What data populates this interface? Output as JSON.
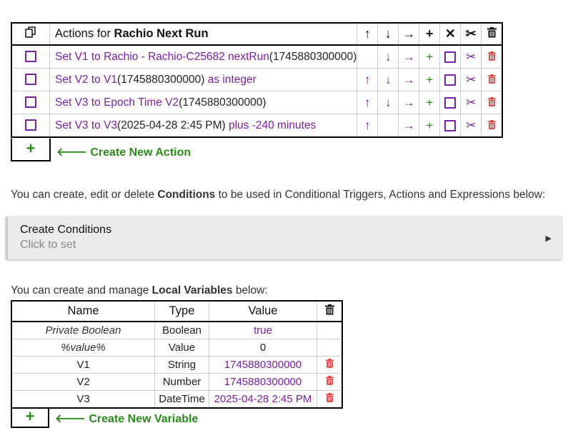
{
  "actions": {
    "header_prefix": "Actions for ",
    "header_name": "Rachio Next Run",
    "header_icons": [
      "↑",
      "↓",
      "→",
      "+",
      "✕",
      "✂",
      "🗑"
    ],
    "rows": [
      {
        "purple1": "Set V1 to Rachio - Rachio-C25682 nextRun",
        "black": "(1745880300000)",
        "purple2": "",
        "up": "",
        "down": "↓"
      },
      {
        "purple1": "Set V2 to V1",
        "black": "(1745880300000)",
        "purple2": " as integer",
        "up": "↑",
        "down": "↓"
      },
      {
        "purple1": "Set V3 to Epoch Time V2",
        "black": "(1745880300000)",
        "purple2": "",
        "up": "↑",
        "down": "↓"
      },
      {
        "purple1": "Set V3 to V3",
        "black": "(2025-04-28 2:45 PM)",
        "purple2": " plus -240 minutes",
        "up": "↑",
        "down": ""
      }
    ],
    "right_icon": "→",
    "plus_icon": "+",
    "scissors_icon": "✂",
    "trash_icon": "🗑",
    "add_label": "+",
    "create_label": "Create New Action",
    "create_arrow": "🡐"
  },
  "conditions": {
    "info_prefix": "You can create, edit or delete ",
    "info_bold": "Conditions",
    "info_suffix": " to be used in Conditional Triggers, Actions and Expressions below:",
    "title": "Create Conditions",
    "subtitle": "Click to set",
    "arrow": "▶"
  },
  "variables": {
    "info_prefix": "You can create and manage ",
    "info_bold": "Local Variables",
    "info_suffix": " below:",
    "headers": [
      "Name",
      "Type",
      "Value"
    ],
    "rows": [
      {
        "name": "Private Boolean",
        "type": "Boolean",
        "value": "true"
      },
      {
        "name": "%value%",
        "type": "Value",
        "value": "0"
      },
      {
        "name": "V1",
        "type": "String",
        "value": "1745880300000"
      },
      {
        "name": "V2",
        "type": "Number",
        "value": "1745880300000"
      },
      {
        "name": "V3",
        "type": "DateTime",
        "value": "2025-04-28 2:45 PM"
      }
    ],
    "add_label": "+",
    "create_label": "Create New Variable",
    "create_arrow": "🡐"
  },
  "colors": {
    "accent_purple": "#7b1fa2",
    "accent_green": "#2a8a1b",
    "delete_red": "#e53935"
  }
}
